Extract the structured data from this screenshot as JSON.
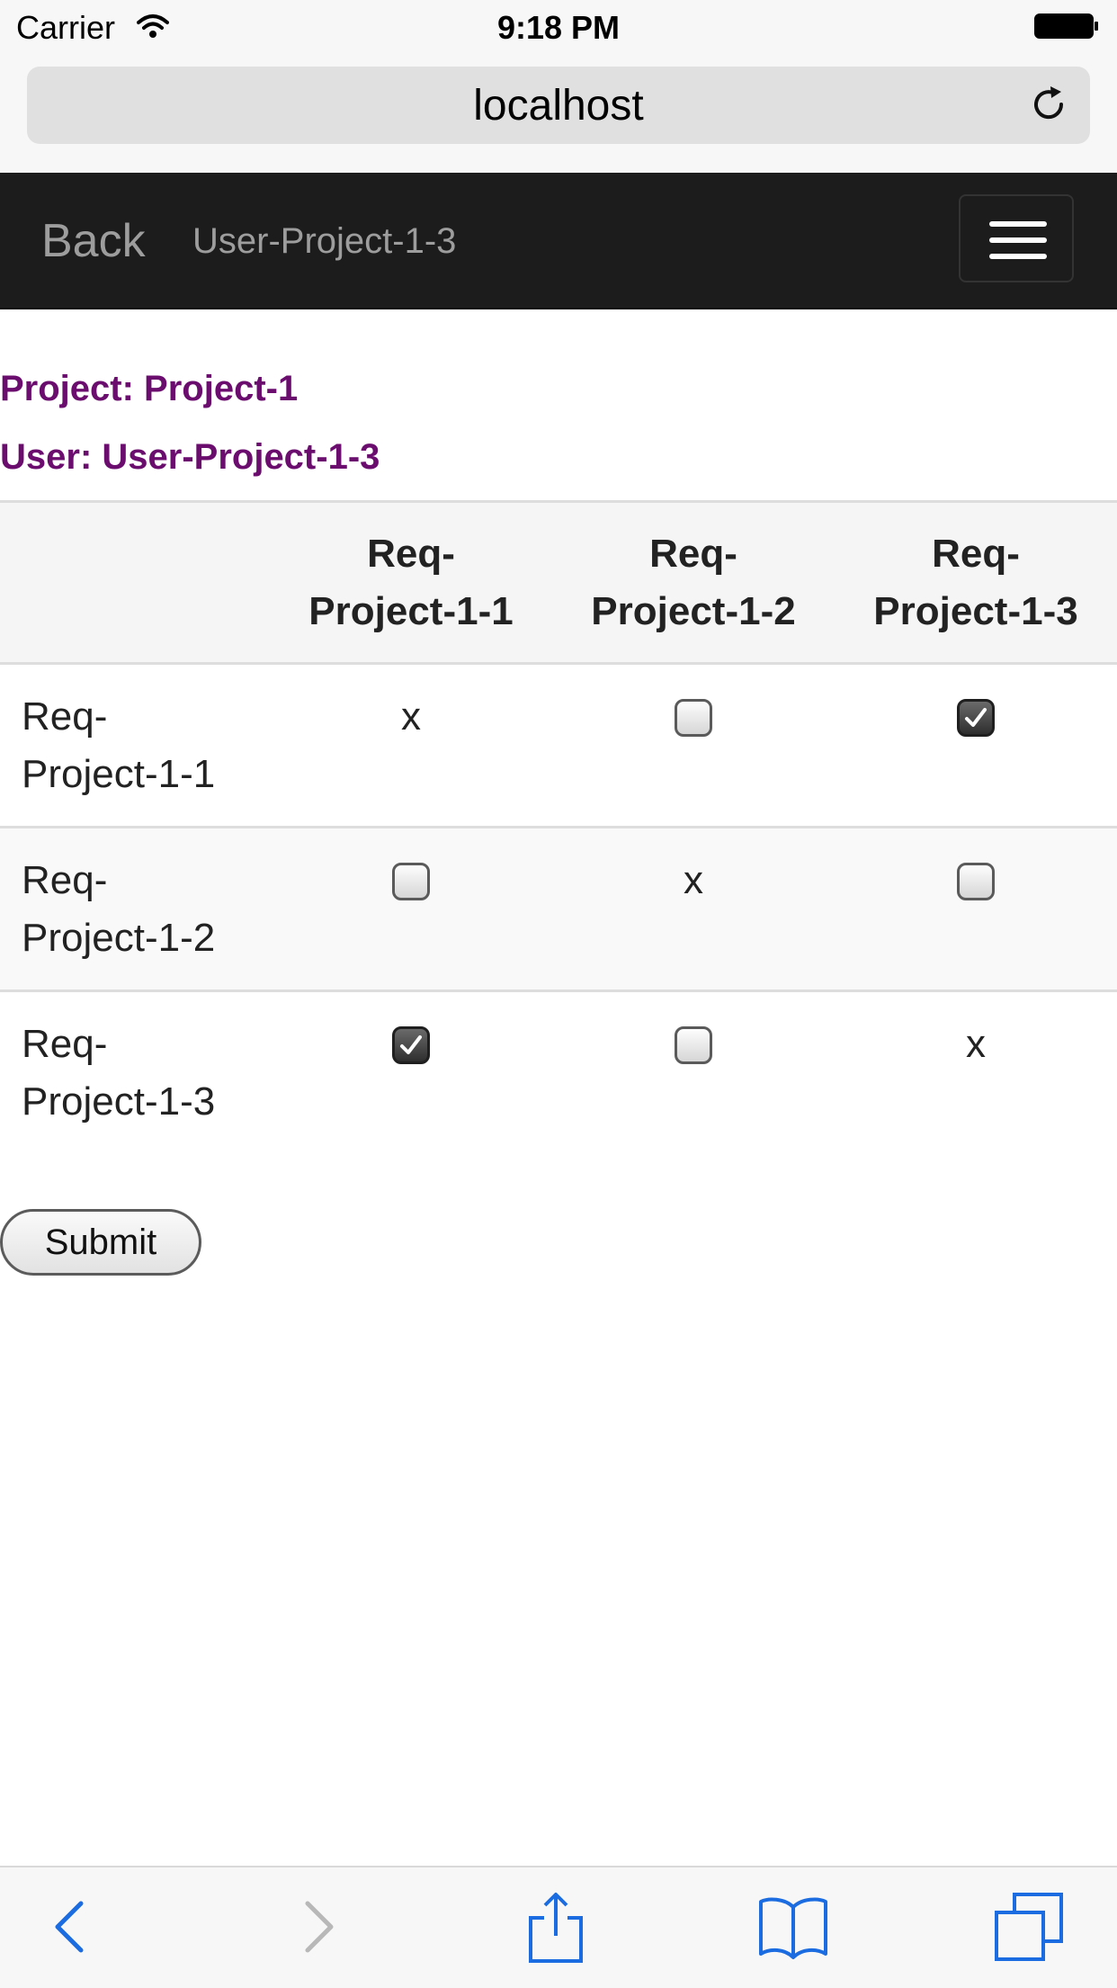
{
  "status_bar": {
    "carrier": "Carrier",
    "time": "9:18 PM"
  },
  "browser": {
    "url": "localhost"
  },
  "navbar": {
    "back_label": "Back",
    "title": "User-Project-1-3"
  },
  "info": {
    "project_line": "Project: Project-1",
    "user_line": "User: User-Project-1-3"
  },
  "matrix": {
    "columns": [
      "Req-\nProject-1-1",
      "Req-\nProject-1-2",
      "Req-\nProject-1-3"
    ],
    "rows": [
      {
        "label": "Req-\nProject-1-1",
        "cells": [
          {
            "type": "self",
            "text": "x"
          },
          {
            "type": "checkbox",
            "checked": false
          },
          {
            "type": "checkbox",
            "checked": true
          }
        ]
      },
      {
        "label": "Req-\nProject-1-2",
        "cells": [
          {
            "type": "checkbox",
            "checked": false
          },
          {
            "type": "self",
            "text": "x"
          },
          {
            "type": "checkbox",
            "checked": false
          }
        ]
      },
      {
        "label": "Req-\nProject-1-3",
        "cells": [
          {
            "type": "checkbox",
            "checked": true
          },
          {
            "type": "checkbox",
            "checked": false
          },
          {
            "type": "self",
            "text": "x"
          }
        ]
      }
    ]
  },
  "form": {
    "submit_label": "Submit"
  },
  "colors": {
    "navbar_bg": "#1c1c1c",
    "info_text": "#6a0d6e",
    "toolbar_active_icon": "#1a6ce0",
    "toolbar_disabled_icon": "#b8b8b8"
  },
  "toolbar": {
    "icons": [
      "back-arrow-icon",
      "forward-arrow-icon",
      "share-icon",
      "bookmarks-icon",
      "tabs-icon"
    ]
  }
}
